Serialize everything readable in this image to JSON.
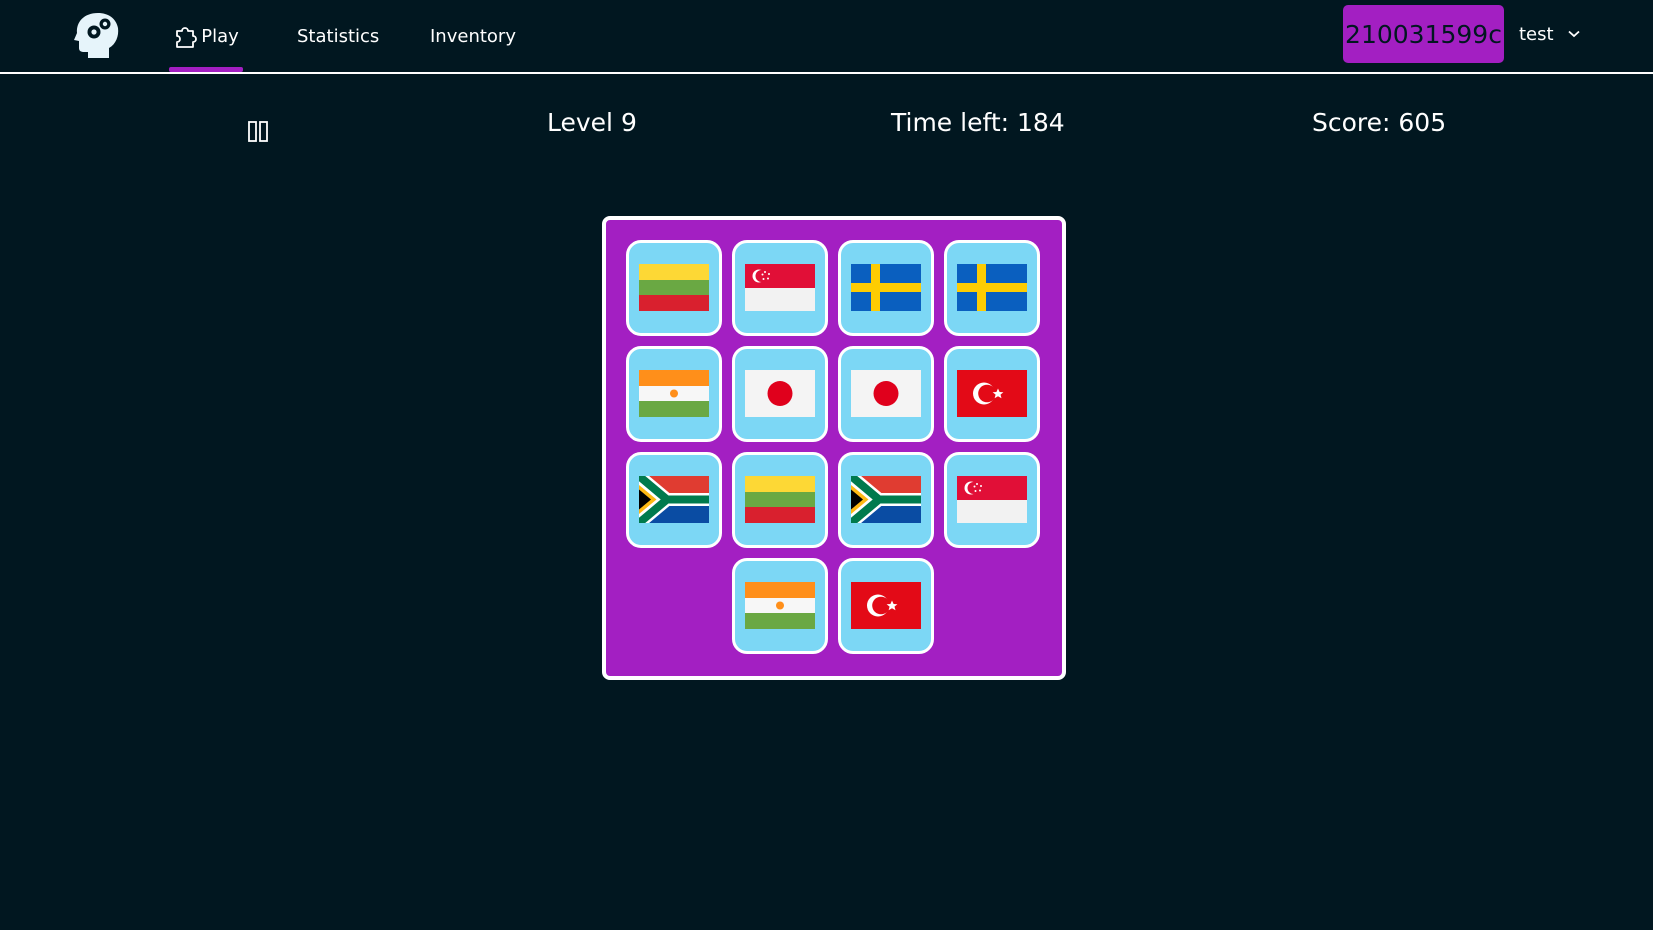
{
  "nav": {
    "tabs": [
      {
        "label": "Play",
        "active": true
      },
      {
        "label": "Statistics"
      },
      {
        "label": "Inventory"
      }
    ],
    "code": "210031599c",
    "user": "test"
  },
  "game": {
    "level": "Level 9",
    "time": "Time left: 184",
    "score": "Score: 605"
  },
  "board": {
    "rows": [
      [
        "lithuania",
        "singapore",
        "sweden",
        "sweden"
      ],
      [
        "niger",
        "japan",
        "japan",
        "turkey"
      ],
      [
        "south-africa",
        "lithuania",
        "south-africa",
        "singapore"
      ],
      [
        "",
        "niger",
        "turkey",
        ""
      ]
    ]
  },
  "colors": {
    "background": "#011720",
    "accent": "#a31fc2",
    "card": "#7cd7f5",
    "white": "#ffffff"
  }
}
